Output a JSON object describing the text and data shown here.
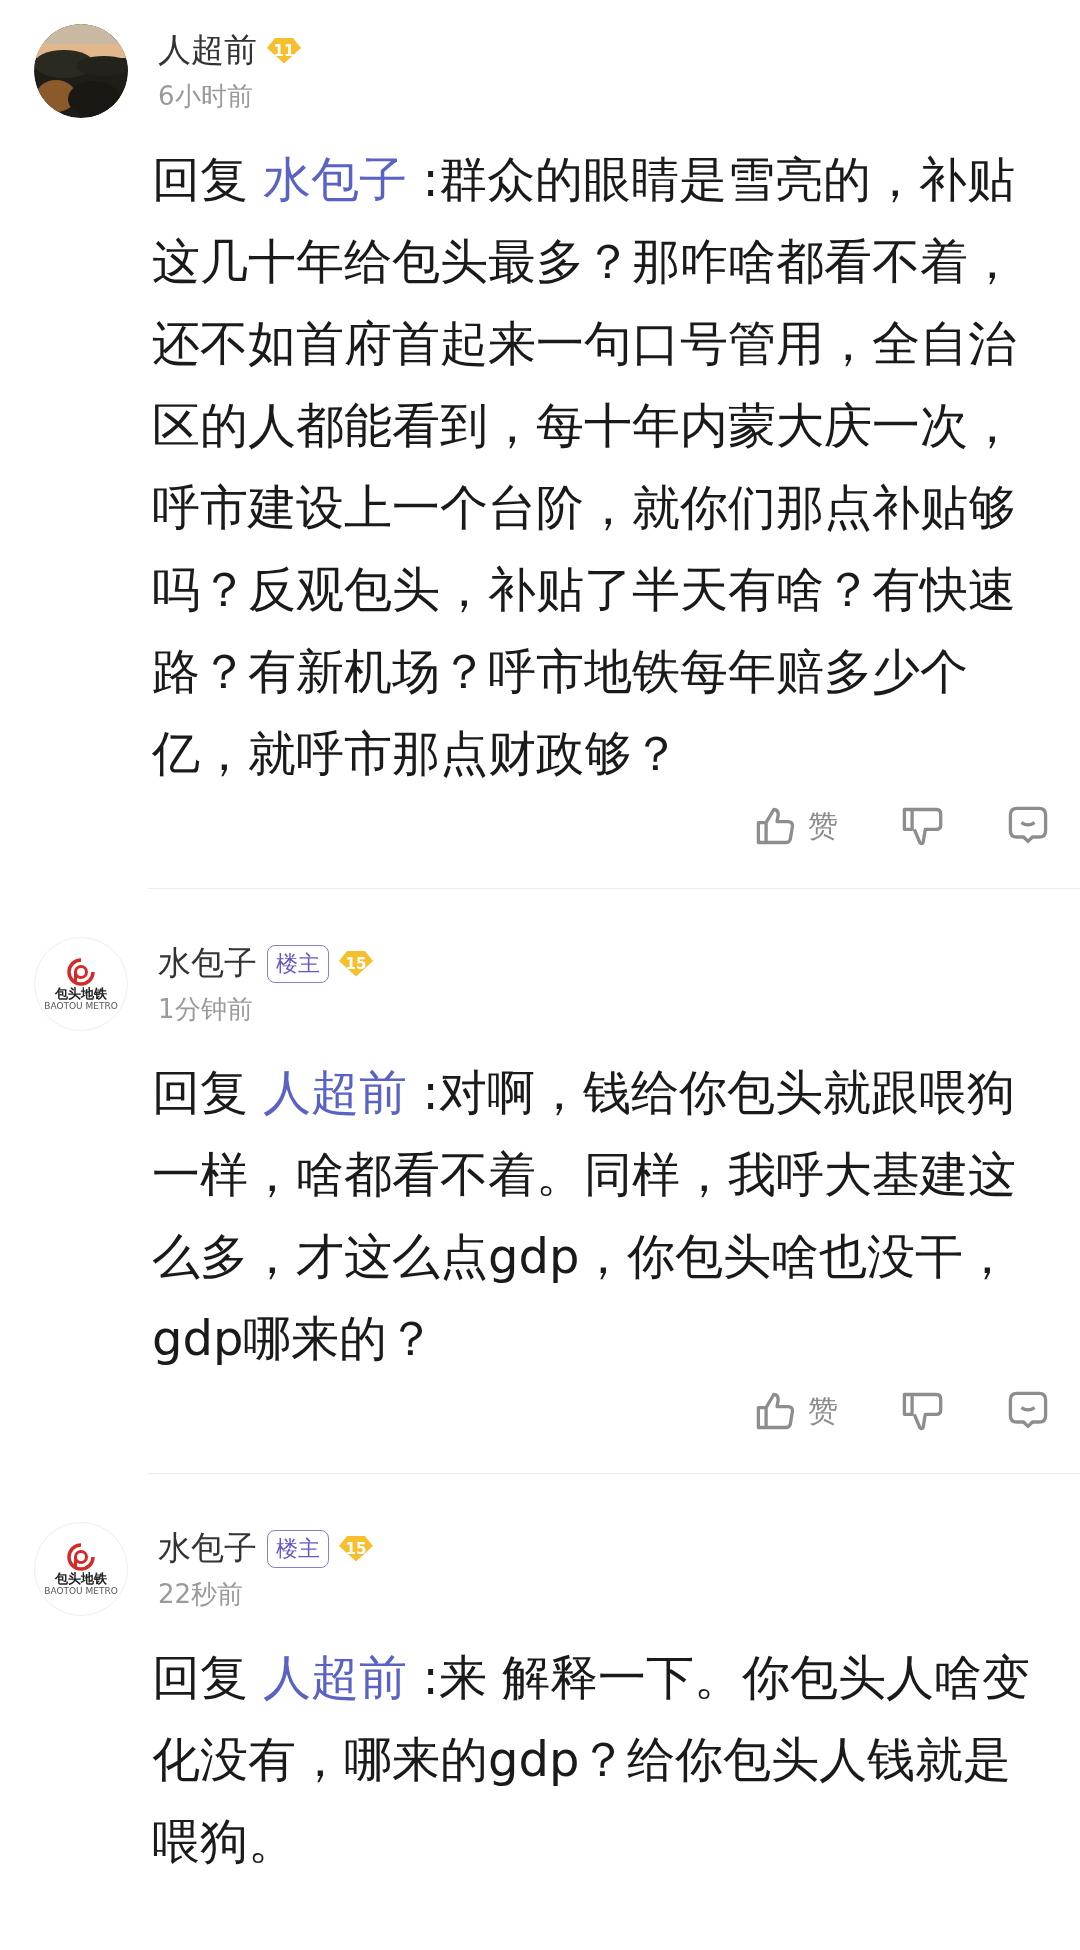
{
  "comments": [
    {
      "author": "人超前",
      "level": "11",
      "time": "6小时前",
      "reply_prefix": "回复",
      "mention": "水包子",
      "text": ":群众的眼睛是雪亮的，补贴这几十年给包头最多？那咋啥都看不着，还不如首府首起来一句口号管用，全自治区的人都能看到，每十年内蒙大庆一次，呼市建设上一个台阶，就你们那点补贴够吗？反观包头，补贴了半天有啥？有快速路？有新机场？呼市地铁每年赔多少个亿，就呼市那点财政够？",
      "like_label": "赞"
    },
    {
      "author": "水包子",
      "avatar": {
        "kind": "logo",
        "title": "包头地铁",
        "subtitle": "BAOTOU METRO"
      },
      "op_tag": "楼主",
      "level": "15",
      "time": "1分钟前",
      "reply_prefix": "回复",
      "mention": "人超前",
      "text": ":对啊，钱给你包头就跟喂狗一样，啥都看不着。同样，我呼大基建这么多，才这么点gdp，你包头啥也没干，gdp哪来的？",
      "like_label": "赞"
    },
    {
      "author": "水包子",
      "avatar": {
        "kind": "logo",
        "title": "包头地铁",
        "subtitle": "BAOTOU METRO"
      },
      "op_tag": "楼主",
      "level": "15",
      "time": "22秒前",
      "reply_prefix": "回复",
      "mention": "人超前",
      "text": ":来 解释一下。你包头人啥变化没有，哪来的gdp？给你包头人钱就是喂狗。"
    }
  ]
}
